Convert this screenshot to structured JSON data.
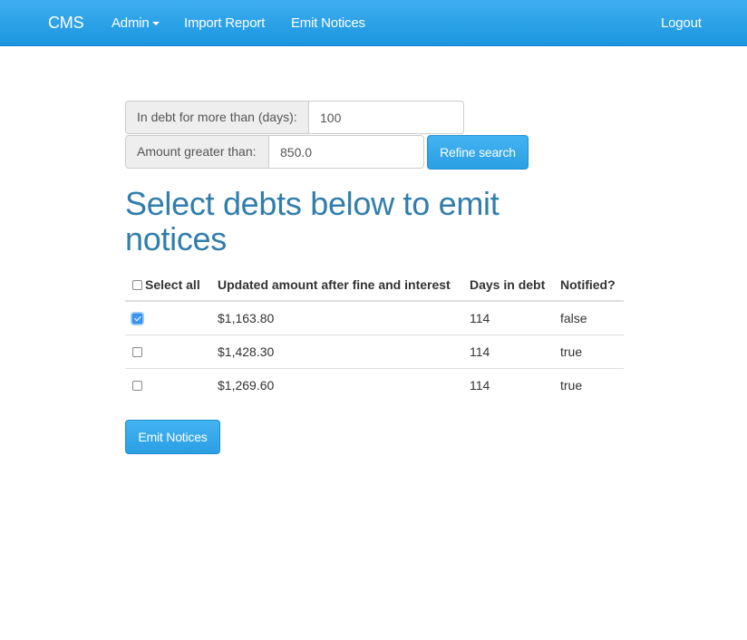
{
  "navbar": {
    "brand": "CMS",
    "admin_label": "Admin",
    "import_label": "Import Report",
    "emit_label": "Emit Notices",
    "logout_label": "Logout"
  },
  "filters": {
    "days_label": "In debt for more than (days):",
    "days_value": "100",
    "amount_label": "Amount greater than:",
    "amount_value": "850.0",
    "refine_label": "Refine search"
  },
  "heading": "Select debts below to emit notices",
  "table": {
    "headers": {
      "select_all": "Select all",
      "amount": "Updated amount after fine and interest",
      "days": "Days in debt",
      "notified": "Notified?"
    },
    "select_all_checked": false,
    "rows": [
      {
        "checked": true,
        "amount": "$1,163.80",
        "days": "114",
        "notified": "false"
      },
      {
        "checked": false,
        "amount": "$1,428.30",
        "days": "114",
        "notified": "true"
      },
      {
        "checked": false,
        "amount": "$1,269.60",
        "days": "114",
        "notified": "true"
      }
    ]
  },
  "emit_button_label": "Emit Notices",
  "colors": {
    "navbar": "#2a9fe3",
    "heading": "#317eac",
    "button": "#2a9fe3"
  }
}
